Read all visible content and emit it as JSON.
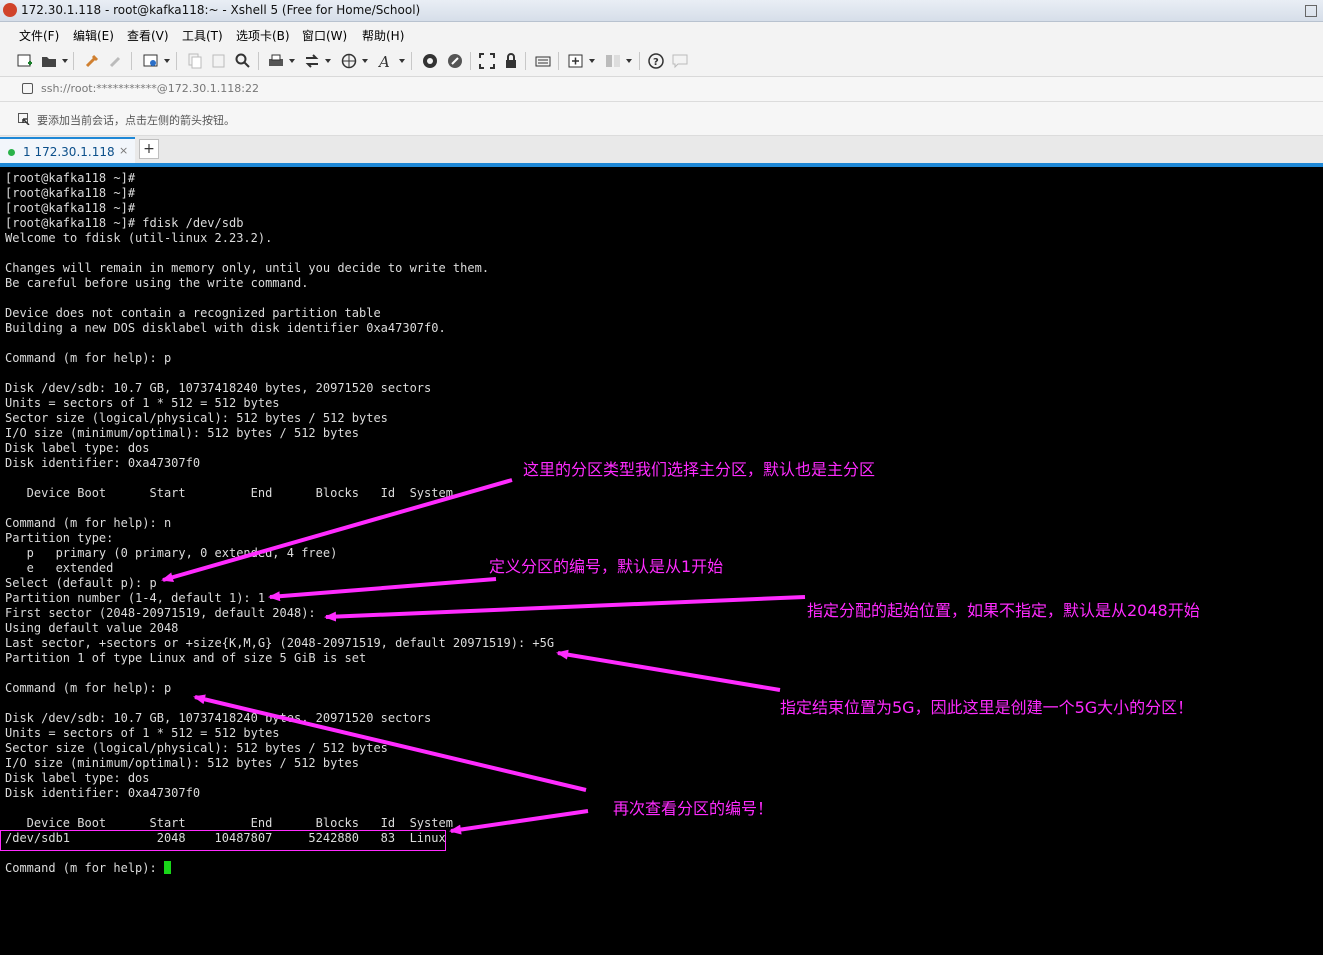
{
  "window": {
    "title": "172.30.1.118 - root@kafka118:~ - Xshell 5 (Free for Home/School)"
  },
  "menu": [
    "文件(F)",
    "编辑(E)",
    "查看(V)",
    "工具(T)",
    "选项卡(B)",
    "窗口(W)",
    "帮助(H)"
  ],
  "toolbar": {
    "icons": [
      "new-session-icon",
      "open-folder-icon",
      "connect-icon",
      "disconnect-icon",
      "properties-icon",
      "copy-icon",
      "paste-icon",
      "find-icon",
      "print-icon",
      "transfer-icon",
      "globe-icon",
      "font-icon",
      "xftp-icon",
      "xmanager-icon",
      "fullscreen-icon",
      "lock-icon",
      "keyboard-icon",
      "add-tab-icon",
      "layout-icon",
      "help-icon",
      "chat-icon"
    ]
  },
  "address": {
    "text": "ssh://root:***********@172.30.1.118:22"
  },
  "info": {
    "text": "要添加当前会话，点击左侧的箭头按钮。"
  },
  "tab": {
    "label": "1 172.30.1.118",
    "close": "×",
    "add": "+"
  },
  "colors": {
    "annotation": "#ff2bff",
    "tab_accent": "#1e88d6",
    "cursor": "#19d619",
    "terminal_bg": "#000000",
    "terminal_fg": "#dcdcdc"
  },
  "terminal": {
    "lines": [
      "[root@kafka118 ~]#",
      "[root@kafka118 ~]#",
      "[root@kafka118 ~]#",
      "[root@kafka118 ~]# fdisk /dev/sdb",
      "Welcome to fdisk (util-linux 2.23.2).",
      "",
      "Changes will remain in memory only, until you decide to write them.",
      "Be careful before using the write command.",
      "",
      "Device does not contain a recognized partition table",
      "Building a new DOS disklabel with disk identifier 0xa47307f0.",
      "",
      "Command (m for help): p",
      "",
      "Disk /dev/sdb: 10.7 GB, 10737418240 bytes, 20971520 sectors",
      "Units = sectors of 1 * 512 = 512 bytes",
      "Sector size (logical/physical): 512 bytes / 512 bytes",
      "I/O size (minimum/optimal): 512 bytes / 512 bytes",
      "Disk label type: dos",
      "Disk identifier: 0xa47307f0",
      "",
      "   Device Boot      Start         End      Blocks   Id  System",
      "",
      "Command (m for help): n",
      "Partition type:",
      "   p   primary (0 primary, 0 extended, 4 free)",
      "   e   extended",
      "Select (default p): p",
      "Partition number (1-4, default 1): 1",
      "First sector (2048-20971519, default 2048):",
      "Using default value 2048",
      "Last sector, +sectors or +size{K,M,G} (2048-20971519, default 20971519): +5G",
      "Partition 1 of type Linux and of size 5 GiB is set",
      "",
      "Command (m for help): p",
      "",
      "Disk /dev/sdb: 10.7 GB, 10737418240 bytes, 20971520 sectors",
      "Units = sectors of 1 * 512 = 512 bytes",
      "Sector size (logical/physical): 512 bytes / 512 bytes",
      "I/O size (minimum/optimal): 512 bytes / 512 bytes",
      "Disk label type: dos",
      "Disk identifier: 0xa47307f0",
      "",
      "   Device Boot      Start         End      Blocks   Id  System",
      "/dev/sdb1            2048    10487807     5242880   83  Linux",
      "",
      "Command (m for help): "
    ]
  },
  "annotations": [
    "这里的分区类型我们选择主分区，默认也是主分区",
    "定义分区的编号，默认是从1开始",
    "指定分配的起始位置，如果不指定，默认是从2048开始",
    "指定结束位置为5G，因此这里是创建一个5G大小的分区！",
    "再次查看分区的编号！"
  ]
}
